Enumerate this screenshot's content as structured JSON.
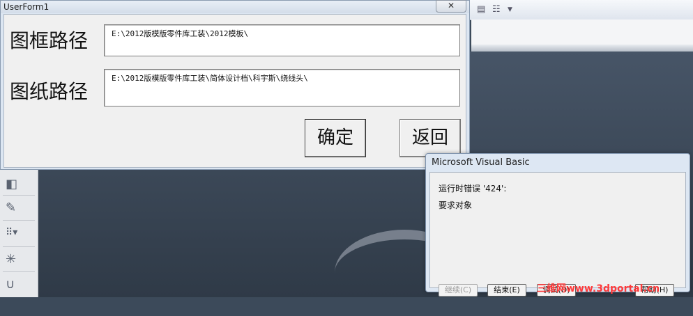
{
  "userform": {
    "title": "UserForm1",
    "close_glyph": "✕",
    "frame_path_label": "图框路径",
    "frame_path_value": "E:\\2012版模版零件库工装\\2012模板\\",
    "drawing_path_label": "图纸路径",
    "drawing_path_value": "E:\\2012版模版零件库工装\\简体设计档\\科宇斯\\绕线头\\",
    "ok_button": "确定",
    "back_button": "返回"
  },
  "vb_dialog": {
    "title": "Microsoft Visual Basic",
    "error_line": "运行时错误 '424':",
    "message": "要求对象",
    "buttons": {
      "continue": "继续(C)",
      "end": "结束(E)",
      "debug": "调试(D)",
      "help": "帮助(H)"
    }
  },
  "watermark": "三维网www.3dportal.cn",
  "icons": [
    "properties-icon",
    "list-view-icon",
    "cube-icon",
    "wand-icon",
    "pattern-icon",
    "sparkle-icon",
    "curve-icon"
  ]
}
